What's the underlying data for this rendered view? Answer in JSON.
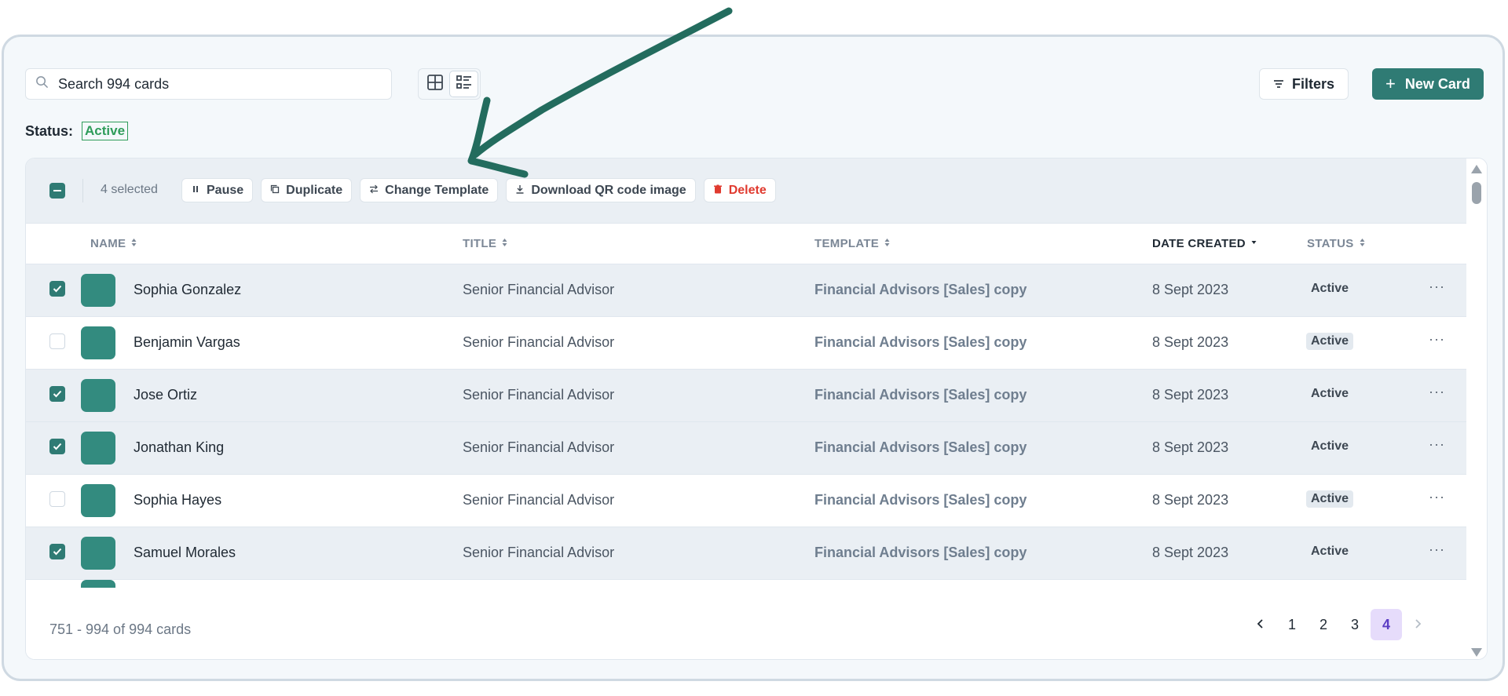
{
  "search": {
    "placeholder": "Search 994 cards",
    "icon": "search-icon"
  },
  "view_toggle": {
    "grid_icon": "grid-icon",
    "list_icon": "list-icon",
    "active": "list"
  },
  "filters": {
    "label": "Filters",
    "icon": "filter-icon"
  },
  "new_card": {
    "label": "New Card",
    "icon": "plus-icon"
  },
  "status_filter": {
    "label": "Status:",
    "value": "Active"
  },
  "bulk": {
    "selected_text": "4 selected",
    "actions": {
      "pause": "Pause",
      "duplicate": "Duplicate",
      "change_template": "Change Template",
      "download_qr": "Download QR code image",
      "delete": "Delete"
    }
  },
  "columns": {
    "name": "NAME",
    "title": "TITLE",
    "template": "TEMPLATE",
    "date_created": "DATE CREATED",
    "status": "STATUS"
  },
  "rows": [
    {
      "selected": true,
      "name": "Sophia Gonzalez",
      "title": "Senior Financial Advisor",
      "template": "Financial Advisors [Sales] copy",
      "date": "8 Sept 2023",
      "status": "Active"
    },
    {
      "selected": false,
      "name": "Benjamin Vargas",
      "title": "Senior Financial Advisor",
      "template": "Financial Advisors [Sales] copy",
      "date": "8 Sept 2023",
      "status": "Active"
    },
    {
      "selected": true,
      "name": "Jose Ortiz",
      "title": "Senior Financial Advisor",
      "template": "Financial Advisors [Sales] copy",
      "date": "8 Sept 2023",
      "status": "Active"
    },
    {
      "selected": true,
      "name": "Jonathan King",
      "title": "Senior Financial Advisor",
      "template": "Financial Advisors [Sales] copy",
      "date": "8 Sept 2023",
      "status": "Active"
    },
    {
      "selected": false,
      "name": "Sophia Hayes",
      "title": "Senior Financial Advisor",
      "template": "Financial Advisors [Sales] copy",
      "date": "8 Sept 2023",
      "status": "Active"
    },
    {
      "selected": true,
      "name": "Samuel Morales",
      "title": "Senior Financial Advisor",
      "template": "Financial Advisors [Sales] copy",
      "date": "8 Sept 2023",
      "status": "Active"
    }
  ],
  "pagination": {
    "range_text": "751 - 994 of 994 cards",
    "pages": [
      "1",
      "2",
      "3",
      "4"
    ],
    "current": "4"
  },
  "colors": {
    "accent": "#2f7b74",
    "avatar": "#338b7f",
    "active_green": "#2f9c5a",
    "delete_red": "#e03a2f",
    "current_page": "#5b3cc4",
    "annotation_arrow": "#236c5e"
  }
}
